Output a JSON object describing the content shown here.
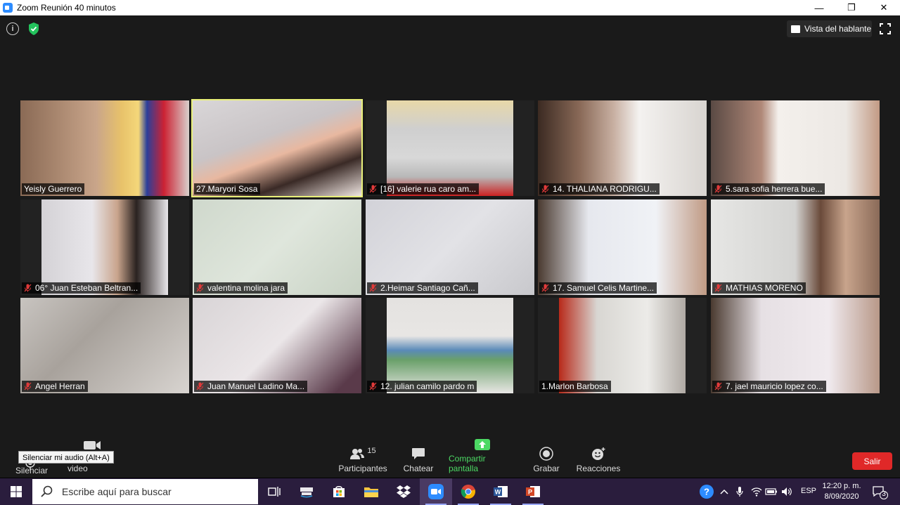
{
  "window": {
    "title": "Zoom Reunión 40 minutos"
  },
  "top_bar": {
    "speaker_view_label": "Vista del hablante"
  },
  "participants": [
    {
      "name": "Yeisly Guerrero",
      "muted": false
    },
    {
      "name": "27.Maryori Sosa",
      "muted": false,
      "active_speaker": true
    },
    {
      "name": "[16] valerie rua caro am...",
      "muted": true
    },
    {
      "name": "14. THALIANA RODRIGU...",
      "muted": true
    },
    {
      "name": "5.sara sofia herrera bue...",
      "muted": true
    },
    {
      "name": "06° Juan Esteban Beltran...",
      "muted": true
    },
    {
      "name": "valentina molina jara",
      "muted": true
    },
    {
      "name": "2.Heimar Santiago Cañ...",
      "muted": true
    },
    {
      "name": "17. Samuel Celis Martine...",
      "muted": true
    },
    {
      "name": "MATHIAS MORENO",
      "muted": true
    },
    {
      "name": "Angel Herran",
      "muted": true
    },
    {
      "name": "Juan Manuel Ladino Ma...",
      "muted": true
    },
    {
      "name": "12. julian camilo pardo m",
      "muted": true
    },
    {
      "name": "1.Marlon Barbosa",
      "muted": false
    },
    {
      "name": "7. jael mauricio lopez co...",
      "muted": true
    }
  ],
  "controls": {
    "mute_tooltip": "Silenciar mi audio (Alt+A)",
    "mute_label": "Silenciar",
    "video_label": "Detener video",
    "participants_label": "Participantes",
    "participants_count": "15",
    "chat_label": "Chatear",
    "share_label": "Compartir pantalla",
    "record_label": "Grabar",
    "reactions_label": "Reacciones",
    "leave_label": "Salir"
  },
  "taskbar": {
    "search_placeholder": "Escribe aquí para buscar",
    "language": "ESP",
    "time": "12:20 p. m.",
    "date": "8/09/2020",
    "notification_count": "3",
    "apps": [
      "task-view-icon",
      "prime-video-icon",
      "store-icon",
      "file-explorer-icon",
      "dropbox-icon",
      "zoom-icon",
      "chrome-icon",
      "word-icon",
      "powerpoint-icon"
    ]
  },
  "colors": {
    "accent_share": "#4cd964",
    "leave_button": "#e02828",
    "active_speaker_border": "#e9f07a",
    "taskbar_bg": "#2a1d3d"
  }
}
